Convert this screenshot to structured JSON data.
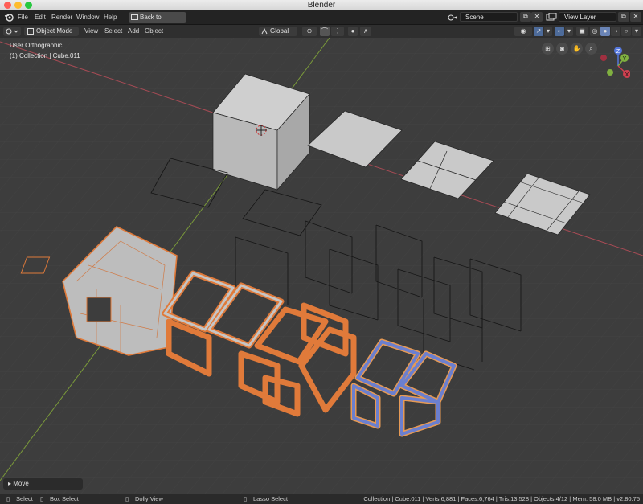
{
  "window": {
    "title": "Blender"
  },
  "menu": {
    "items": [
      "File",
      "Edit",
      "Render",
      "Window",
      "Help"
    ],
    "back_button": "Back to Previous"
  },
  "scene": {
    "label": "Scene",
    "view_layer": "View Layer"
  },
  "header": {
    "mode": "Object Mode",
    "menus": [
      "View",
      "Select",
      "Add",
      "Object"
    ],
    "orientation": "Global"
  },
  "viewport": {
    "view_name": "User Orthographic",
    "collection_info": "(1) Collection | Cube.011"
  },
  "gizmo": {
    "z": "Z",
    "y": "Y",
    "x": "X"
  },
  "operator_panel": {
    "label": "Move"
  },
  "status": {
    "select": "Select",
    "box_select": "Box Select",
    "dolly_view": "Dolly View",
    "lasso_select": "Lasso Select",
    "stats": "Collection | Cube.011 | Verts:6,881 | Faces:6,764 | Tris:13,528 | Objects:4/12 | Mem: 58.0 MB | v2.80.75"
  },
  "icons": [
    "blender-logo-icon",
    "editor-type-icon",
    "object-mode-icon",
    "transform-orientation-icon",
    "pivot-icon",
    "snap-icon",
    "proportional-edit-icon",
    "visibility-icon",
    "gizmo-icon",
    "overlay-icon",
    "xray-icon",
    "shading-solid-icon",
    "grid-view-icon",
    "camera-icon",
    "hand-pan-icon",
    "zoom-icon",
    "scene-icon",
    "view-layer-icon",
    "mouse-icon"
  ],
  "colors": {
    "accent_orange": "#e07a3a",
    "selection_blue": "#6b7fcf",
    "x_axis": "#a84b55",
    "y_axis": "#7a9a3a"
  }
}
